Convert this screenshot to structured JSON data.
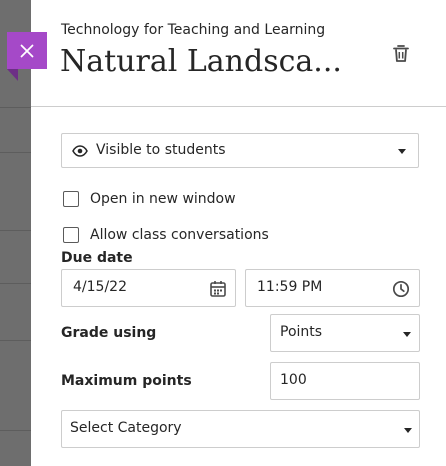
{
  "panel": {
    "course_name": "Technology for Teaching and Learning",
    "title": "Natural Landsca..."
  },
  "visibility": {
    "selected": "Visible to students"
  },
  "options": {
    "open_new_window": {
      "label": "Open in new window",
      "checked": false
    },
    "class_conversations": {
      "label": "Allow class conversations",
      "checked": false
    }
  },
  "due_date": {
    "label": "Due date",
    "date": "4/15/22",
    "time": "11:59 PM"
  },
  "grade": {
    "label": "Grade using",
    "selected": "Points"
  },
  "max_points": {
    "label": "Maximum points",
    "value": "100"
  },
  "category": {
    "selected": "Select Category"
  },
  "colors": {
    "accent": "#a549c8",
    "backdrop": "#6e6e6e",
    "border": "#cdcdcd",
    "text": "#262626"
  },
  "icons": [
    "close-icon",
    "trash-icon",
    "eye-icon",
    "chevron-down-icon",
    "calendar-icon",
    "clock-icon"
  ]
}
